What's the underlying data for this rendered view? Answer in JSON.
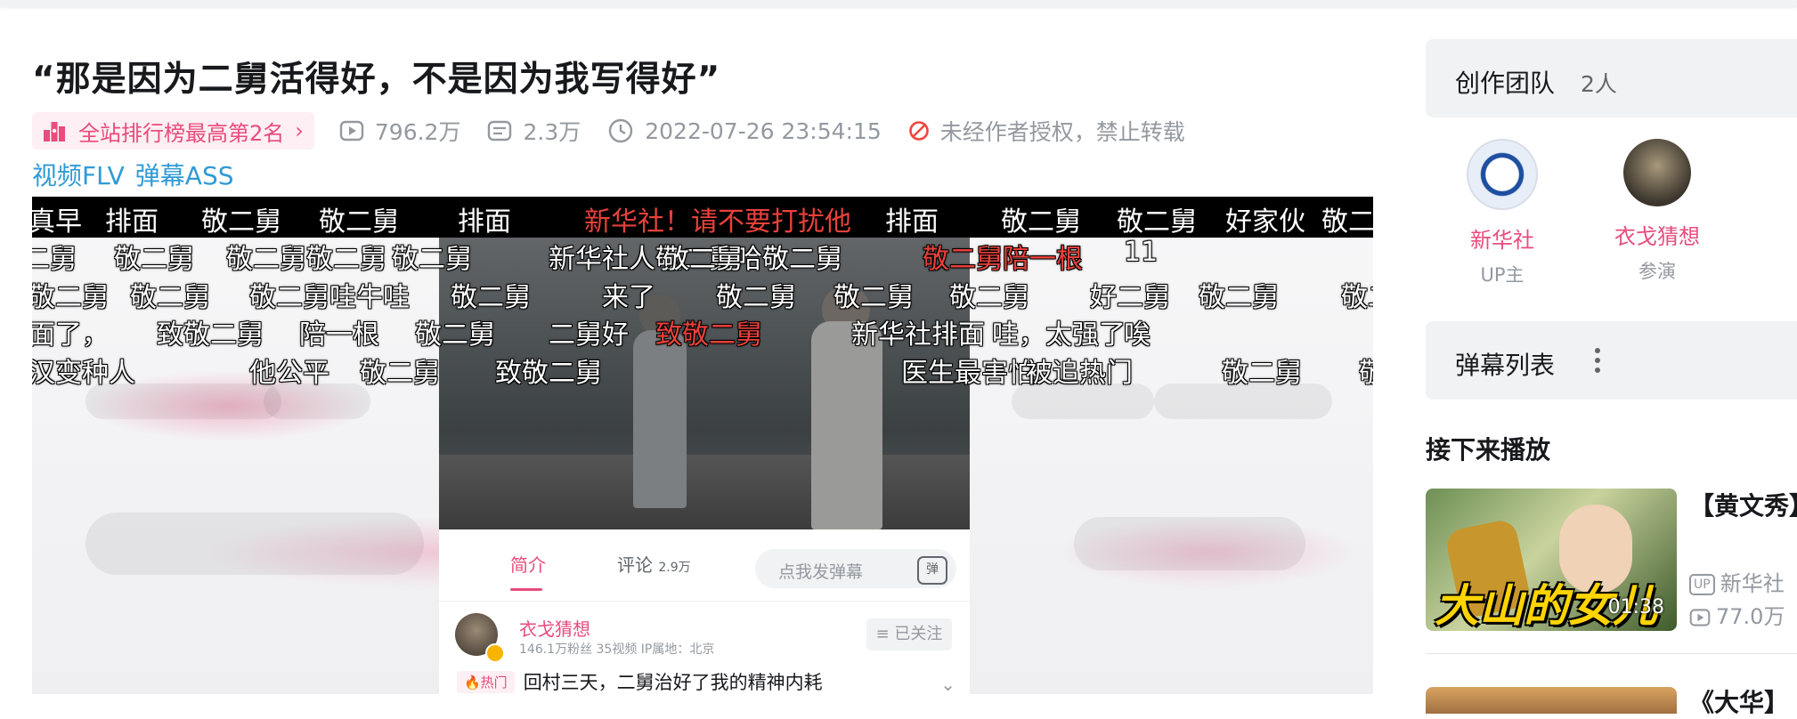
{
  "video": {
    "title": "“那是因为二舅活得好，不是因为我写得好”",
    "rank_badge": "全站排行榜最高第2名",
    "views": "796.2万",
    "danmaku_count": "2.3万",
    "pubdate": "2022-07-26 23:54:15",
    "copyright": "未经作者授权，禁止转载",
    "download_links": [
      "视频FLV",
      "弹幕ASS"
    ]
  },
  "danmaku": [
    {
      "text": "真早",
      "row": 0,
      "color": "white"
    },
    {
      "text": "排面",
      "row": 0,
      "color": "white"
    },
    {
      "text": "敬二舅",
      "row": 0,
      "color": "white"
    },
    {
      "text": "敬二舅",
      "row": 0,
      "color": "white"
    },
    {
      "text": "排面",
      "row": 0,
      "color": "white"
    },
    {
      "text": "新华社！请不要打扰他",
      "row": 0,
      "color": "red"
    },
    {
      "text": "排面",
      "row": 0,
      "color": "white"
    },
    {
      "text": "敬二舅",
      "row": 0,
      "color": "white"
    },
    {
      "text": "敬二舅",
      "row": 0,
      "color": "white"
    },
    {
      "text": "好家伙",
      "row": 0,
      "color": "white"
    },
    {
      "text": "敬二",
      "row": 0,
      "color": "white"
    },
    {
      "text": "二舅",
      "row": 1,
      "color": "white"
    },
    {
      "text": "敬二舅",
      "row": 1,
      "color": "white"
    },
    {
      "text": "敬二舅敬二舅",
      "row": 1,
      "color": "white"
    },
    {
      "text": "敬二舅",
      "row": 1,
      "color": "white"
    },
    {
      "text": "新华社人敬二舅哈敬二舅",
      "row": 1,
      "color": "white"
    },
    {
      "text": "敬二舅",
      "row": 1,
      "color": "white"
    },
    {
      "text": "敬二舅",
      "row": 1,
      "color": "red"
    },
    {
      "text": "陪一根",
      "row": 1,
      "color": "red"
    },
    {
      "text": "11",
      "row": 1,
      "color": "white"
    },
    {
      "text": "敬二舅",
      "row": 2,
      "color": "white"
    },
    {
      "text": "敬二舅",
      "row": 2,
      "color": "white"
    },
    {
      "text": "敬二舅哇牛哇",
      "row": 2,
      "color": "white"
    },
    {
      "text": "敬二舅",
      "row": 2,
      "color": "white"
    },
    {
      "text": "来了",
      "row": 2,
      "color": "white"
    },
    {
      "text": "敬二舅",
      "row": 2,
      "color": "white"
    },
    {
      "text": "敬二舅",
      "row": 2,
      "color": "white"
    },
    {
      "text": "敬二舅",
      "row": 2,
      "color": "white"
    },
    {
      "text": "好二舅",
      "row": 2,
      "color": "white"
    },
    {
      "text": "敬二舅",
      "row": 2,
      "color": "white"
    },
    {
      "text": "敬二舅",
      "row": 2,
      "color": "white"
    },
    {
      "text": "面了，",
      "row": 3,
      "color": "white"
    },
    {
      "text": "致敬二舅",
      "row": 3,
      "color": "white"
    },
    {
      "text": "陪一根",
      "row": 3,
      "color": "white"
    },
    {
      "text": "敬二舅",
      "row": 3,
      "color": "white"
    },
    {
      "text": "二舅好",
      "row": 3,
      "color": "white"
    },
    {
      "text": "致敬二舅",
      "row": 3,
      "color": "red"
    },
    {
      "text": "新华社排面",
      "row": 3,
      "color": "white"
    },
    {
      "text": "哇，太强了",
      "row": 3,
      "color": "white"
    },
    {
      "text": "唉",
      "row": 3,
      "color": "white"
    },
    {
      "text": "汉变种人",
      "row": 4,
      "color": "white"
    },
    {
      "text": "他公平",
      "row": 4,
      "color": "white"
    },
    {
      "text": "敬二舅",
      "row": 4,
      "color": "white"
    },
    {
      "text": "致敬二舅",
      "row": 4,
      "color": "white"
    },
    {
      "text": "医生最害怕",
      "row": 4,
      "color": "white"
    },
    {
      "text": "被追热门",
      "row": 4,
      "color": "white"
    },
    {
      "text": "敬二舅",
      "row": 4,
      "color": "white"
    },
    {
      "text": "敬",
      "row": 4,
      "color": "white"
    }
  ],
  "phone": {
    "tabs": [
      {
        "label": "简介"
      },
      {
        "label": "评论"
      }
    ],
    "comment_count": "2.9万",
    "danmaku_placeholder": "点我发弹幕",
    "danmaku_btn": "弹",
    "author_name": "衣戈猜想",
    "author_stats": "146.1万粉丝   35视频   IP属地：北京",
    "follow_label": "≡ 已关注",
    "hot_tag": "🔥热门",
    "hot_text": "回村三天，二舅治好了我的精神内耗"
  },
  "sidebar": {
    "team_title": "创作团队",
    "team_count": "2人",
    "members": [
      {
        "name": "新华社",
        "role": "UP主"
      },
      {
        "name": "衣戈猜想",
        "role": "参演"
      }
    ],
    "danmaku_list_title": "弹幕列表",
    "next_title": "接下来播放",
    "next_video": {
      "title": "【黄文秀】到底该有",
      "thumb_text": "大山的女儿",
      "duration": "01:38",
      "up": "新华社",
      "views": "77.0万"
    },
    "next_video_2_title": "《大华】"
  },
  "colors": {
    "accent": "#e84c7d",
    "link": "#2f9bd6",
    "muted": "#9499a0"
  }
}
